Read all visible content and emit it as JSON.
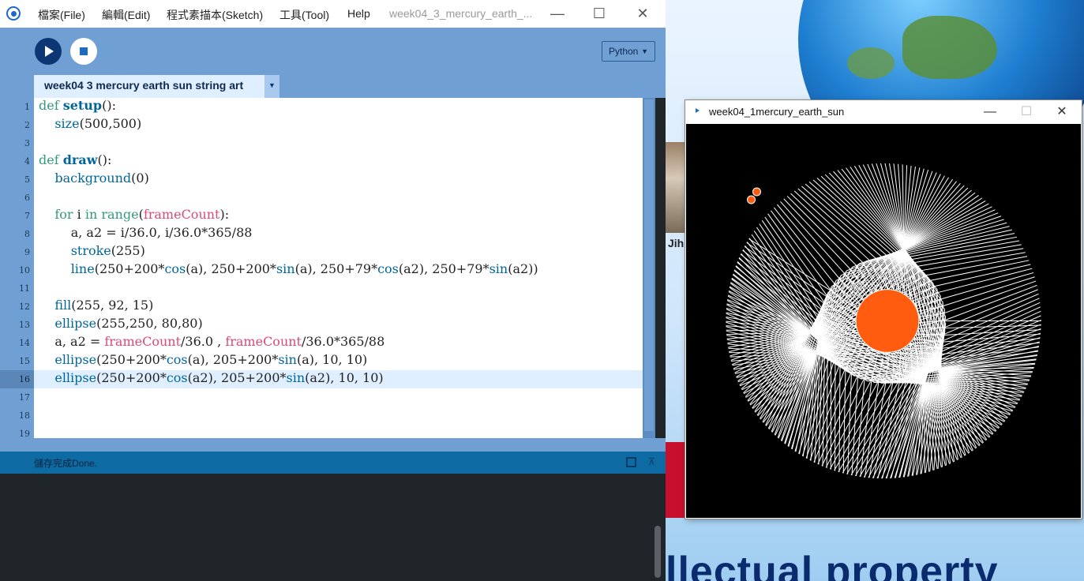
{
  "ide": {
    "menu": [
      "檔案(File)",
      "編輯(Edit)",
      "程式素描本(Sketch)",
      "工具(Tool)",
      "Help"
    ],
    "window_title": "week04_3_mercury_earth_...",
    "mode": "Python",
    "tab_label": "week04 3 mercury earth sun string art",
    "line_numbers": [
      "1",
      "2",
      "3",
      "4",
      "5",
      "6",
      "7",
      "8",
      "9",
      "10",
      "11",
      "12",
      "13",
      "14",
      "15",
      "16",
      "17",
      "18",
      "19"
    ],
    "active_line": "16",
    "status": "儲存完成Done."
  },
  "code": {
    "l1": "def setup():",
    "l2": "    size(500,500)",
    "l4": "def draw():",
    "l5": "    background(0)",
    "l7": "    for i in range(frameCount):",
    "l8": "        a, a2 = i/36.0, i/36.0*365/88",
    "l9": "        stroke(255)",
    "l10": "        line(250+200*cos(a), 250+200*sin(a), 250+79*cos(a2), 250+79*sin(a2))",
    "l12": "    fill(255, 92, 15)",
    "l13": "    ellipse(255,250, 80,80)",
    "l14": "    a, a2 = frameCount/36.0 , frameCount/36.0*365/88",
    "l15": "    ellipse(250+200*cos(a), 205+200*sin(a), 10, 10)",
    "l16": "    ellipse(250+200*cos(a2), 205+200*sin(a2), 10, 10)"
  },
  "sketch": {
    "title": "week04_1mercury_earth_sun",
    "background_color": "#000000",
    "stroke_color": "#ffffff",
    "sun_color": "#ff5c0f",
    "frame_count": 360
  },
  "desktop": {
    "side_text": "Jih",
    "banner": "llectual property"
  },
  "colors": {
    "toolbar": "#6f9fd3",
    "status_bar": "#0e6aa3",
    "tab": "#e0efff",
    "keyword": "#33997e",
    "builtin": "#006699",
    "processing_var": "#d94a7a"
  }
}
